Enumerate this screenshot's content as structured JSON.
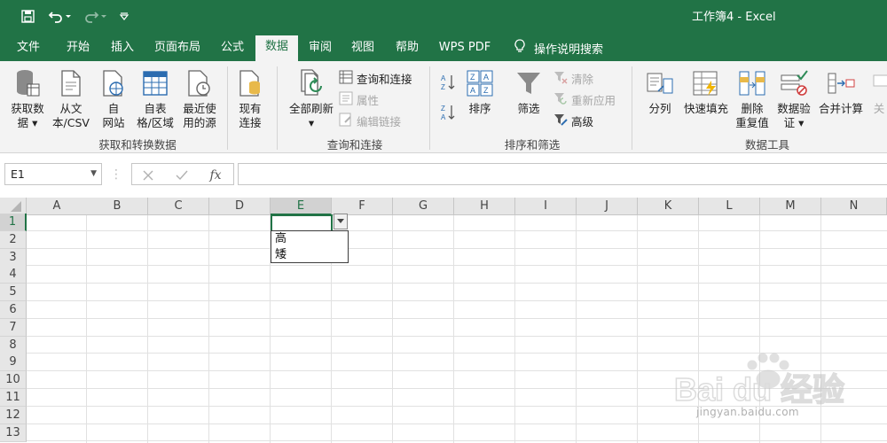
{
  "title_bar": {
    "title": "工作簿4  -  Excel"
  },
  "colors": {
    "brand_green": "#217346",
    "ribbon_bg": "#f3f3f3",
    "header_bg": "#e6e6e6"
  },
  "menu": {
    "tabs": [
      "文件",
      "开始",
      "插入",
      "页面布局",
      "公式",
      "数据",
      "审阅",
      "视图",
      "帮助",
      "WPS PDF"
    ],
    "active_tab": "数据",
    "tell_me": "操作说明搜索"
  },
  "ribbon": {
    "get_transform": {
      "label": "获取和转换数据",
      "get_data": [
        "获取数",
        "据"
      ],
      "from_text": [
        "从文",
        "本/CSV"
      ],
      "from_web": [
        "自",
        "网站"
      ],
      "from_table": [
        "自表",
        "格/区域"
      ],
      "recent_sources": [
        "最近使",
        "用的源"
      ],
      "existing_connections": [
        "现有",
        "连接"
      ]
    },
    "queries": {
      "label": "查询和连接",
      "refresh_all": "全部刷新",
      "queries_connections": "查询和连接",
      "properties": "属性",
      "edit_links": "编辑链接"
    },
    "sort_filter": {
      "label": "排序和筛选",
      "sort": "排序",
      "filter": "筛选",
      "clear": "清除",
      "reapply": "重新应用",
      "advanced": "高级"
    },
    "data_tools": {
      "label": "数据工具",
      "text_to_columns": "分列",
      "flash_fill": "快速填充",
      "remove_duplicates": [
        "删除",
        "重复值"
      ],
      "data_validation": [
        "数据验",
        "证"
      ],
      "consolidate": "合并计算",
      "cut_off": "关"
    }
  },
  "formula_bar": {
    "name_box": "E1",
    "fx": "fx",
    "value": ""
  },
  "grid": {
    "columns": [
      "A",
      "B",
      "C",
      "D",
      "E",
      "F",
      "G",
      "H",
      "I",
      "J",
      "K",
      "L",
      "M",
      "N"
    ],
    "rows": [
      "1",
      "2",
      "3",
      "4",
      "5",
      "6",
      "7",
      "8",
      "9",
      "10",
      "11",
      "12",
      "13"
    ],
    "active_column": "E",
    "active_row": "1"
  },
  "dropdown": {
    "options": [
      "高",
      "矮"
    ]
  },
  "watermark": {
    "brand": "Bai du 经验",
    "url": "jingyan.baidu.com"
  }
}
